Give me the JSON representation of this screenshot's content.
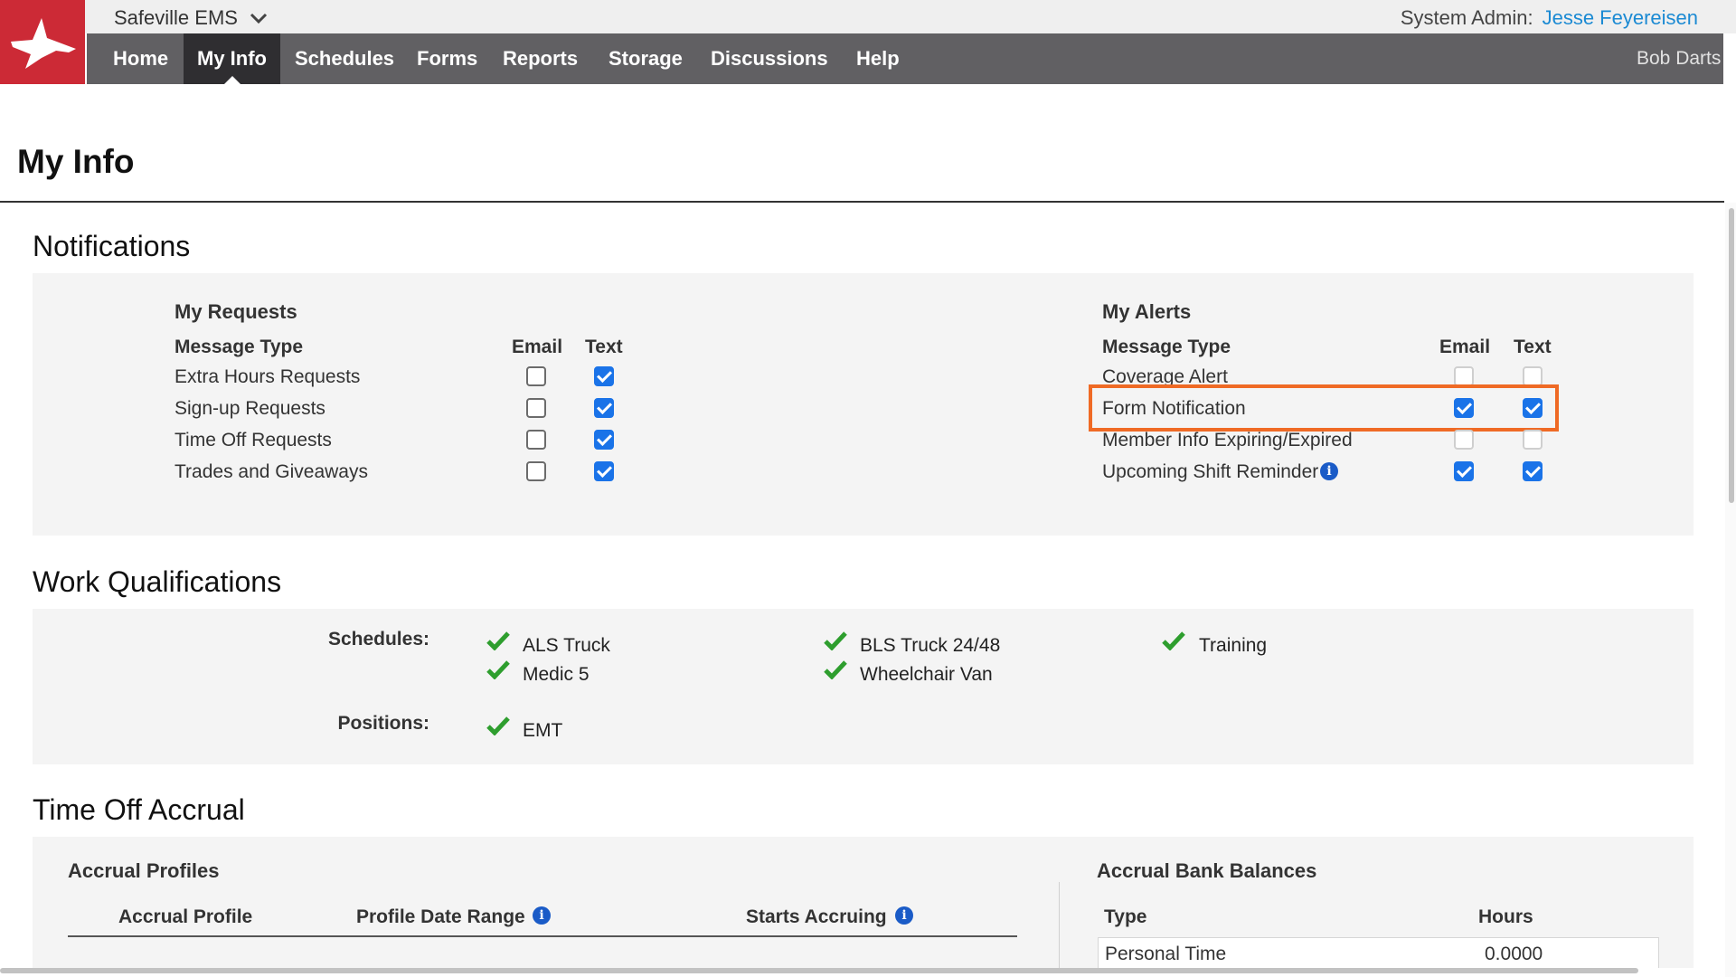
{
  "header": {
    "org_name": "Safeville EMS",
    "admin_label": "System Admin:",
    "admin_name": "Jesse Feyereisen",
    "user_name": "Bob Darts",
    "brand_color": "#cc2a36",
    "nav": [
      {
        "label": "Home",
        "active": false
      },
      {
        "label": "My Info",
        "active": true
      },
      {
        "label": "Schedules",
        "active": false
      },
      {
        "label": "Forms",
        "active": false
      },
      {
        "label": "Reports",
        "active": false
      },
      {
        "label": "Storage",
        "active": false
      },
      {
        "label": "Discussions",
        "active": false
      },
      {
        "label": "Help",
        "active": false
      }
    ]
  },
  "page": {
    "title": "My Info"
  },
  "notifications": {
    "heading": "Notifications",
    "my_requests": {
      "title": "My Requests",
      "col_type": "Message Type",
      "col_email": "Email",
      "col_text": "Text",
      "rows": [
        {
          "label": "Extra Hours Requests",
          "email": false,
          "text": true
        },
        {
          "label": "Sign-up Requests",
          "email": false,
          "text": true
        },
        {
          "label": "Time Off Requests",
          "email": false,
          "text": true
        },
        {
          "label": "Trades and Giveaways",
          "email": false,
          "text": true
        }
      ]
    },
    "my_alerts": {
      "title": "My Alerts",
      "col_type": "Message Type",
      "col_email": "Email",
      "col_text": "Text",
      "rows": [
        {
          "label": "Coverage Alert",
          "email": false,
          "text": false,
          "disabled": true
        },
        {
          "label": "Form Notification",
          "email": true,
          "text": true,
          "highlighted": true
        },
        {
          "label": "Member Info Expiring/Expired",
          "email": false,
          "text": false,
          "disabled": true
        },
        {
          "label": "Upcoming Shift Reminder",
          "email": true,
          "text": true,
          "info": true
        }
      ]
    },
    "highlight_color": "#ef6a25"
  },
  "work_qualifications": {
    "heading": "Work Qualifications",
    "schedules_label": "Schedules:",
    "positions_label": "Positions:",
    "schedules": [
      "ALS Truck",
      "Medic 5",
      "BLS Truck 24/48",
      "Wheelchair Van",
      "Training"
    ],
    "positions": [
      "EMT"
    ],
    "check_color": "#2e9e2e"
  },
  "time_off_accrual": {
    "heading": "Time Off Accrual",
    "profiles_title": "Accrual Profiles",
    "col_profile": "Accrual Profile",
    "col_range": "Profile Date Range",
    "col_starts": "Starts Accruing",
    "balances_title": "Accrual Bank Balances",
    "col_type": "Type",
    "col_hours": "Hours",
    "balances": [
      {
        "type": "Personal Time",
        "hours": "0.0000"
      }
    ]
  }
}
